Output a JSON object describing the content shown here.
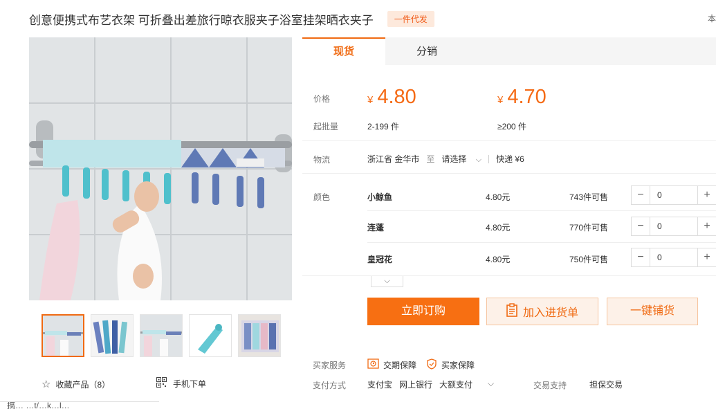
{
  "product": {
    "title": "创意便携式布艺衣架 可折叠出差旅行晾衣服夹子浴室挂架晒衣夹子",
    "badge": "一件代发",
    "cut_right_text": "本"
  },
  "tabs": [
    {
      "label": "现货",
      "active": true
    },
    {
      "label": "分销",
      "active": false
    }
  ],
  "pricing": {
    "price_label": "价格",
    "moq_label": "起批量",
    "currency": "¥",
    "tiers": [
      {
        "price": "4.80",
        "range": "2-199 件"
      },
      {
        "price": "4.70",
        "range": "≥200 件"
      }
    ]
  },
  "logistics": {
    "label": "物流",
    "origin": "浙江省 金华市",
    "to": "至",
    "destination": "请选择",
    "express": "快递 ¥6"
  },
  "color": {
    "label": "颜色",
    "options": [
      {
        "name": "小鲸鱼",
        "price": "4.80元",
        "stock": "743件可售",
        "qty": "0"
      },
      {
        "name": "连蓬",
        "price": "4.80元",
        "stock": "770件可售",
        "qty": "0"
      },
      {
        "name": "皇冠花",
        "price": "4.80元",
        "stock": "750件可售",
        "qty": "0"
      }
    ]
  },
  "actions": {
    "buy": "立即订购",
    "add_cart": "加入进货单",
    "one_key": "一键铺货"
  },
  "services": {
    "label": "买家服务",
    "items": [
      "交期保障",
      "买家保障"
    ]
  },
  "payment": {
    "label": "支付方式",
    "methods": [
      "支付宝",
      "网上银行",
      "大额支付"
    ],
    "trade_label": "交易支持",
    "trade_value": "担保交易"
  },
  "footer": {
    "favorite": "收藏产品（8）",
    "mobile_order": "手机下单",
    "bottom_cut": "搞…      …t/…k…l…"
  },
  "colors": {
    "accent": "#f06a12",
    "accent_light": "#fdf1e8"
  },
  "icons": {
    "star": "star-icon",
    "qr": "qr-code-icon",
    "clipboard": "clipboard-icon",
    "shield": "shield-icon",
    "chevron": "chevron-down-icon"
  }
}
